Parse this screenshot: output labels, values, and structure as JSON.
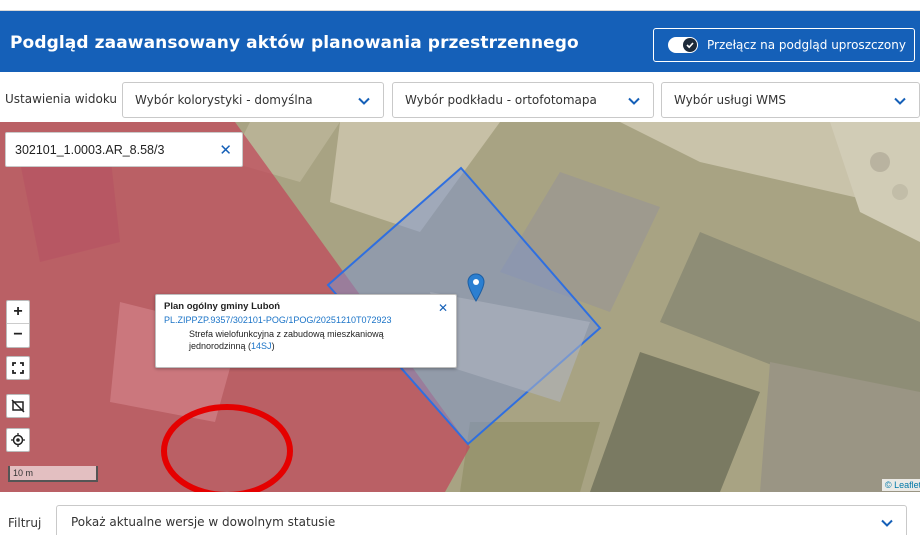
{
  "header": {
    "title": "Podgląd zaawansowany aktów planowania przestrzennego",
    "toggle_label": "Przełącz na podgląd uproszczony"
  },
  "view_settings": {
    "label": "Ustawienia widoku",
    "coloring_select": "Wybór kolorystyki - domyślna",
    "basemap_select": "Wybór podkładu - ortofotomapa",
    "wms_select": "Wybór usługi WMS"
  },
  "map": {
    "search_chip": "302101_1.0003.AR_8.58/3",
    "zoom_in": "+",
    "zoom_out": "−",
    "scale_label": "10 m",
    "attribution": "© Leaflet",
    "popup": {
      "title": "Plan ogólny gminy Luboń",
      "link": "PL.ZIPPZP.9357/302101-POG/1POG/20251210T072923",
      "description": "Strefa wielofunkcyjna z zabudową mieszkaniową jednorodzinną (",
      "zone_code": "14SJ",
      "description_end": ")"
    },
    "colors": {
      "zone_fill": "#c0465a",
      "parcel_stroke": "#2f6fe0",
      "marker": "#2b7fd1",
      "highlight_circle": "#e50000"
    }
  },
  "filter": {
    "label": "Filtruj",
    "value": "Pokaż aktualne wersje w dowolnym statusie"
  }
}
